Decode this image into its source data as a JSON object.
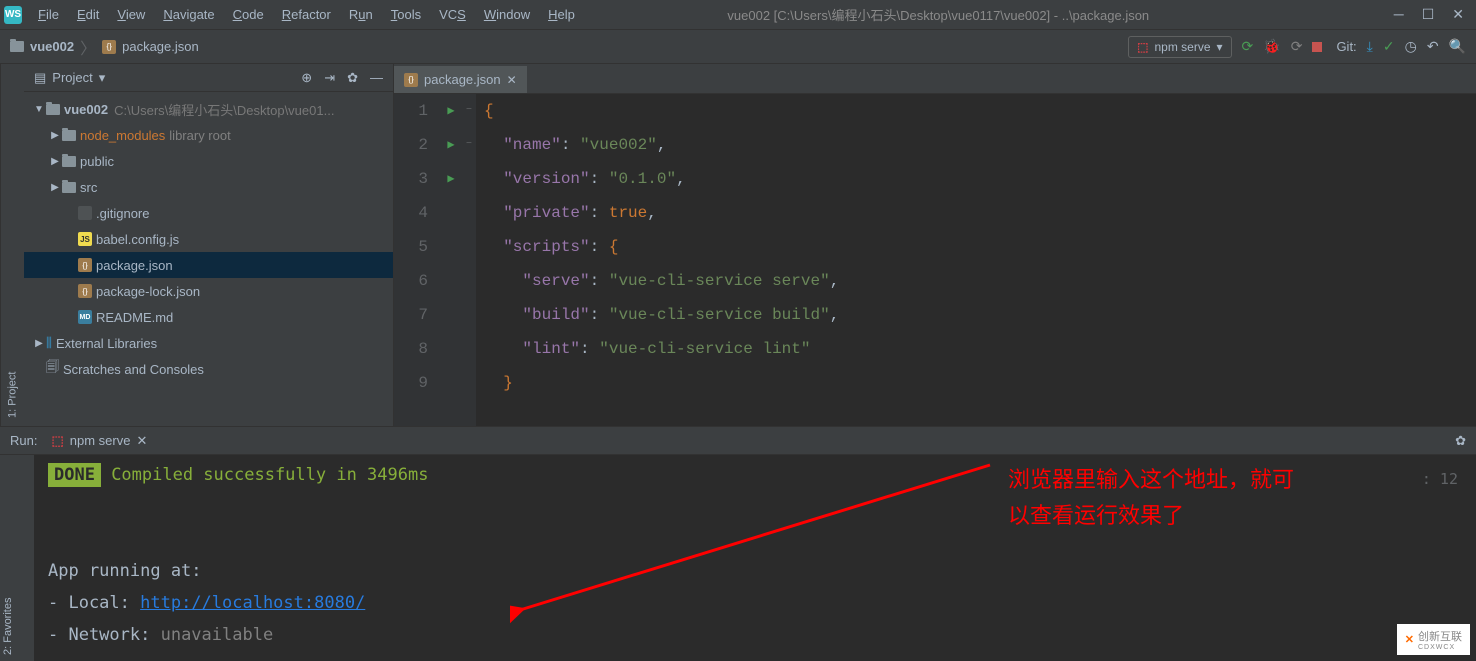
{
  "app": {
    "icon_text": "WS"
  },
  "menu": [
    "File",
    "Edit",
    "View",
    "Navigate",
    "Code",
    "Refactor",
    "Run",
    "Tools",
    "VCS",
    "Window",
    "Help"
  ],
  "title": "vue002 [C:\\Users\\编程小石头\\Desktop\\vue0117\\vue002] - ..\\package.json",
  "breadcrumb": {
    "project": "vue002",
    "file": "package.json"
  },
  "run_config": {
    "label": "npm serve"
  },
  "git_label": "Git:",
  "project_panel": {
    "title": "Project",
    "root": "vue002",
    "root_path": "C:\\Users\\编程小石头\\Desktop\\vue01...",
    "items": [
      {
        "name": "node_modules",
        "suffix": "library root",
        "type": "folder-lib",
        "expandable": true
      },
      {
        "name": "public",
        "type": "folder",
        "expandable": true
      },
      {
        "name": "src",
        "type": "folder",
        "expandable": true
      },
      {
        "name": ".gitignore",
        "type": "file"
      },
      {
        "name": "babel.config.js",
        "type": "js"
      },
      {
        "name": "package.json",
        "type": "json",
        "selected": true
      },
      {
        "name": "package-lock.json",
        "type": "json"
      },
      {
        "name": "README.md",
        "type": "md"
      }
    ],
    "external_libs": "External Libraries",
    "scratches": "Scratches and Consoles"
  },
  "editor": {
    "tab": "package.json",
    "lines": [
      {
        "n": 1,
        "fold": "−",
        "code": "{"
      },
      {
        "n": 2,
        "code": "  \"name\": \"vue002\","
      },
      {
        "n": 3,
        "code": "  \"version\": \"0.1.0\","
      },
      {
        "n": 4,
        "code": "  \"private\": true,"
      },
      {
        "n": 5,
        "fold": "−",
        "code": "  \"scripts\": {"
      },
      {
        "n": 6,
        "run": true,
        "code": "    \"serve\": \"vue-cli-service serve\","
      },
      {
        "n": 7,
        "run": true,
        "code": "    \"build\": \"vue-cli-service build\","
      },
      {
        "n": 8,
        "run": true,
        "code": "    \"lint\": \"vue-cli-service lint\""
      },
      {
        "n": 9,
        "code": "  }"
      }
    ]
  },
  "run_panel": {
    "title": "Run:",
    "tab": "npm serve",
    "done": "DONE",
    "compiled": " Compiled successfully in 3496ms",
    "app_running": "App running at:",
    "local_label": "- Local:   ",
    "local_url": "http://localhost:8080/",
    "network_label": "- Network: ",
    "network_value": "unavailable",
    "time_right": ": 12"
  },
  "annotation": {
    "line1": "浏览器里输入这个地址，就可",
    "line2": "以查看运行效果了"
  },
  "left_tabs": {
    "project": "1: Project",
    "favorites": "2: Favorites"
  },
  "watermark": {
    "brand": "创新互联",
    "sub": "CDXWCX"
  }
}
